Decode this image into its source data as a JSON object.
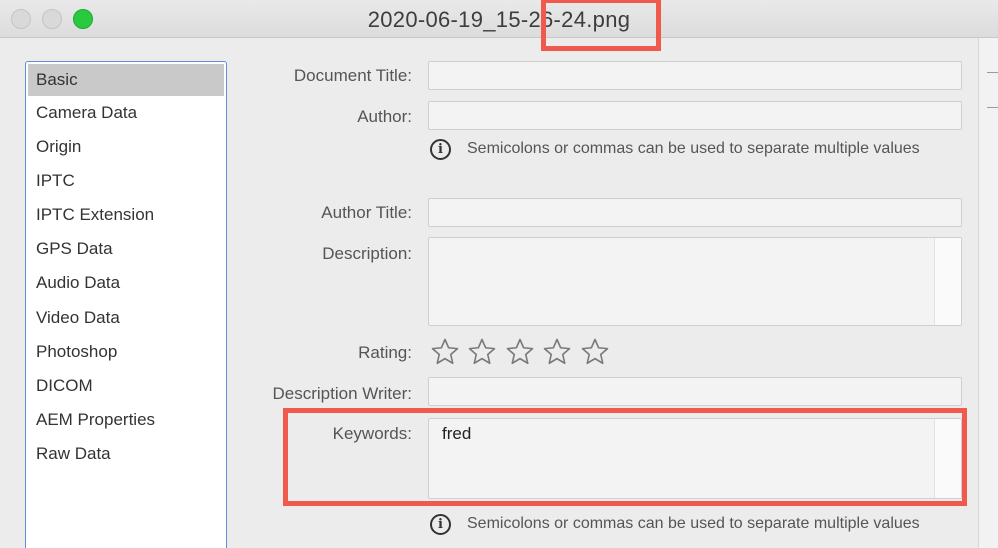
{
  "window": {
    "title": "2020-06-19_15-26-24.png"
  },
  "sidebar": {
    "items": [
      {
        "label": "Basic"
      },
      {
        "label": "Camera Data"
      },
      {
        "label": "Origin"
      },
      {
        "label": "IPTC"
      },
      {
        "label": "IPTC Extension"
      },
      {
        "label": "GPS Data"
      },
      {
        "label": "Audio Data"
      },
      {
        "label": "Video Data"
      },
      {
        "label": "Photoshop"
      },
      {
        "label": "DICOM"
      },
      {
        "label": "AEM Properties"
      },
      {
        "label": "Raw Data"
      }
    ],
    "selected": "Basic"
  },
  "form": {
    "document_title": {
      "label": "Document Title:",
      "value": ""
    },
    "author": {
      "label": "Author:",
      "value": ""
    },
    "author_hint": "Semicolons or commas can be used to separate multiple values",
    "author_title": {
      "label": "Author Title:",
      "value": ""
    },
    "description": {
      "label": "Description:",
      "value": ""
    },
    "rating": {
      "label": "Rating:",
      "value": 0,
      "max": 5
    },
    "description_writer": {
      "label": "Description Writer:",
      "value": ""
    },
    "keywords": {
      "label": "Keywords:",
      "value": "fred"
    },
    "keywords_hint": "Semicolons or commas can be used to separate multiple values"
  },
  "icons": {
    "info": "info-icon",
    "star": "star-outline-icon"
  },
  "colors": {
    "highlight": "#f05a4d",
    "zoom_button": "#29c940",
    "selection": "#c9c9c9"
  }
}
